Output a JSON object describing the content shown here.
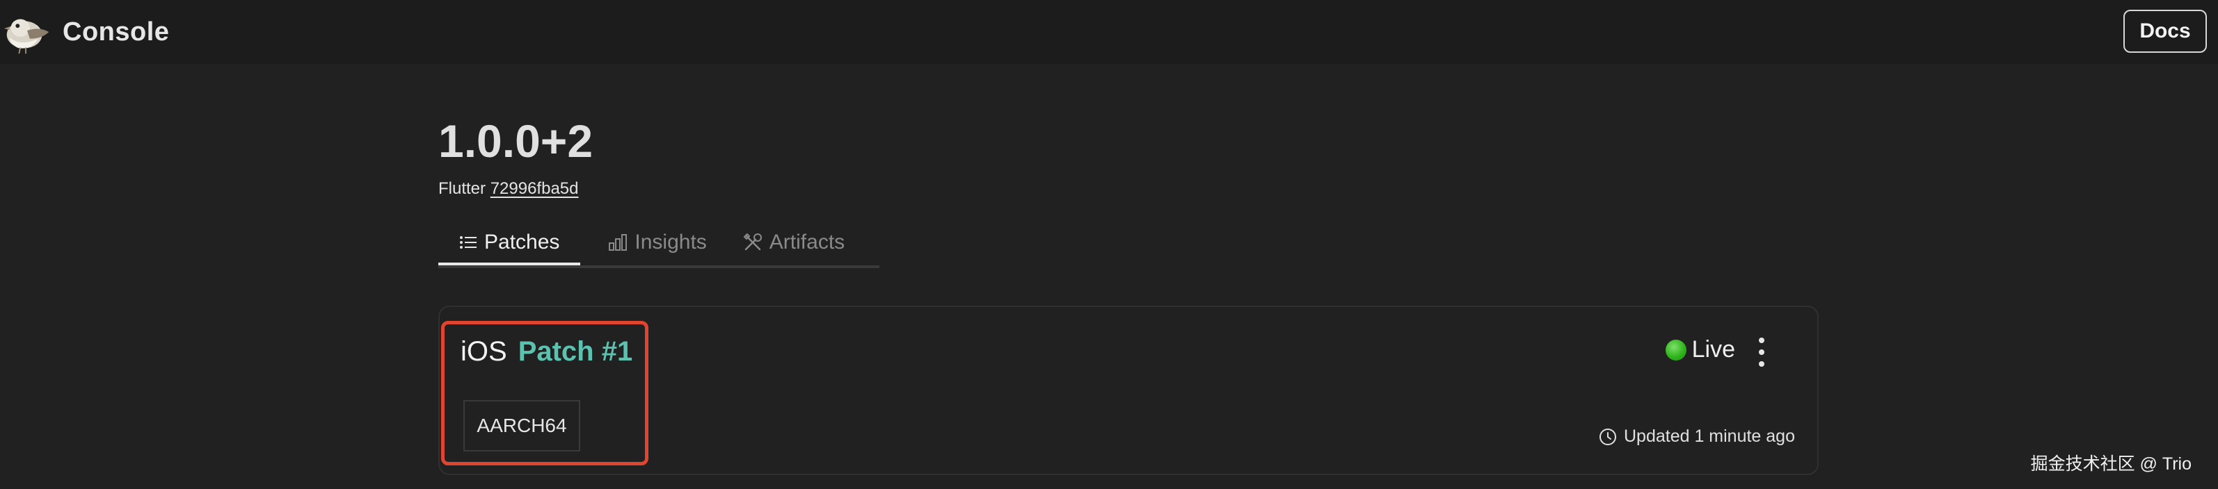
{
  "header": {
    "title": "Console",
    "docs_label": "Docs",
    "logo_icon": "bird-logo-icon"
  },
  "release": {
    "version": "1.0.0+2",
    "flutter_prefix": "Flutter",
    "flutter_hash": "72996fba5d"
  },
  "tabs": [
    {
      "label": "Patches",
      "icon": "list-icon",
      "active": true
    },
    {
      "label": "Insights",
      "icon": "bar-chart-icon",
      "active": false
    },
    {
      "label": "Artifacts",
      "icon": "tools-icon",
      "active": false
    }
  ],
  "patch": {
    "platform": "iOS",
    "name": "Patch #1",
    "arch": "AARCH64",
    "status": "Live",
    "updated": "Updated 1 minute ago"
  },
  "watermark": "掘金技术社区 @ Trio",
  "colors": {
    "background": "#212121",
    "accent": "#5bc2b0",
    "highlight": "#e2452f",
    "live": "#2fb41c"
  }
}
